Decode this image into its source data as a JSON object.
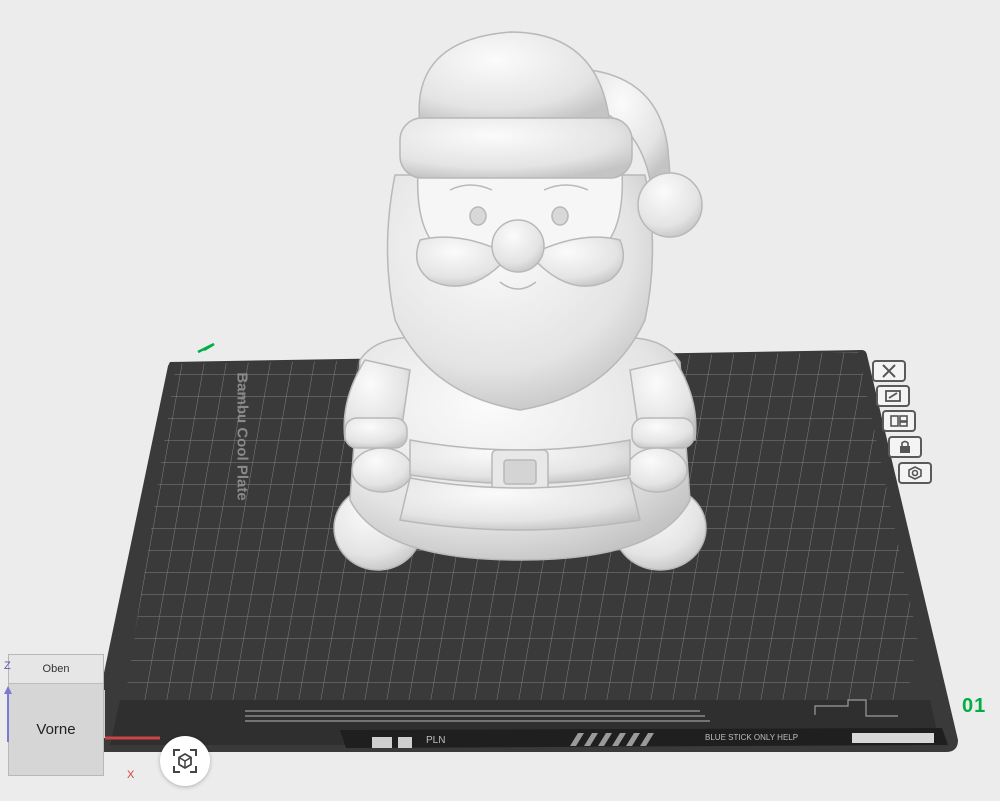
{
  "plate": {
    "name": "Bambu Cool Plate",
    "index": "01",
    "footer_text": "PLN",
    "footer_info": "BLUE STICK ONLY HELP"
  },
  "nav_cube": {
    "top": "Oben",
    "front": "Vorne"
  },
  "axes": {
    "x": "X",
    "z": "Z"
  },
  "icons": {
    "plate_buttons": [
      "close-icon",
      "auto-orient-icon",
      "arrange-icon",
      "lock-icon",
      "settings-icon"
    ],
    "fit": "fit-view-icon"
  },
  "colors": {
    "background": "#ececec",
    "plate": "#3b3b3b",
    "accent": "#00ae42",
    "model": "#f2f2f2"
  }
}
